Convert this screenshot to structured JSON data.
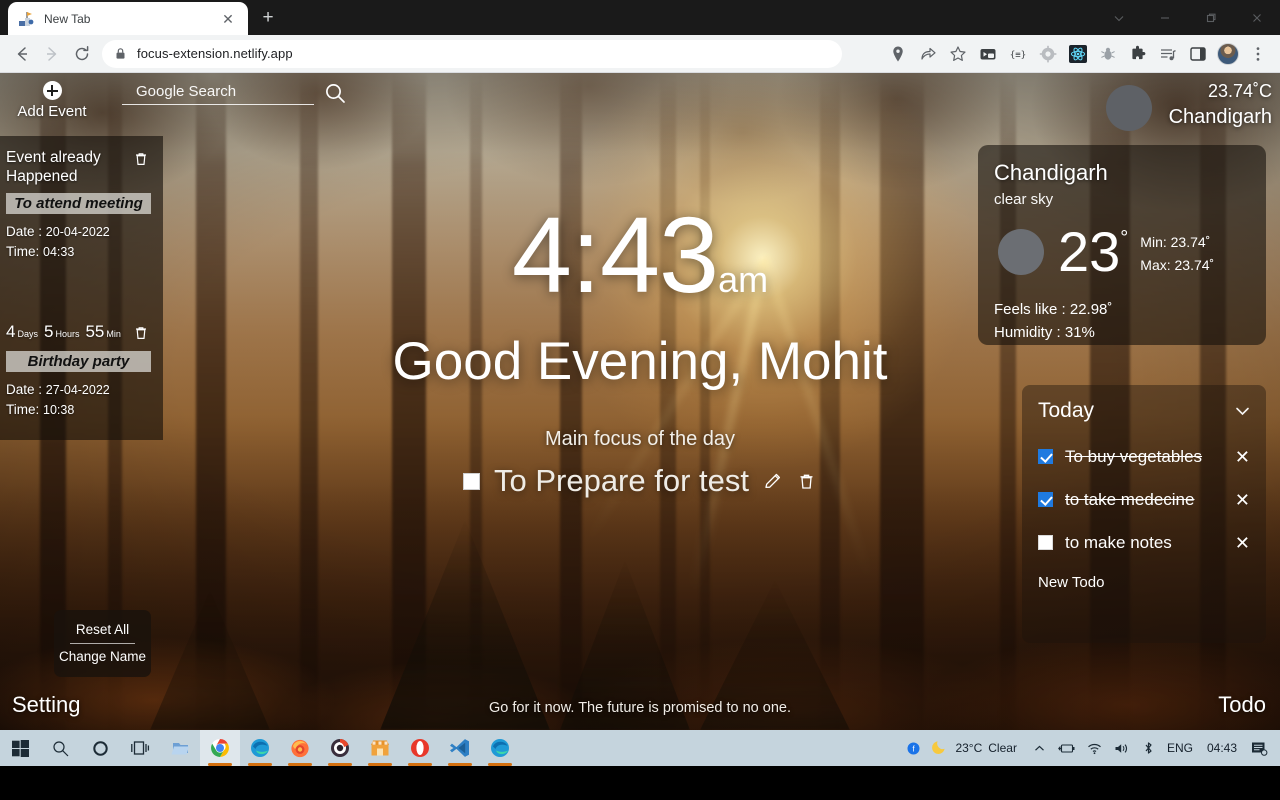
{
  "browser": {
    "tab": {
      "title": "New Tab",
      "favicon": "focus-extension-icon",
      "close": "✕"
    },
    "newtab_label": "+",
    "window_controls": {
      "chevron": "⌄",
      "minimize": "—",
      "maximize": "❐",
      "close": "✕"
    },
    "omnibox": {
      "url": "focus-extension.netlify.app",
      "lock": "lock-icon"
    },
    "extensions": [
      "video-picture-in-picture-icon",
      "json-formatter-icon",
      "gear-extension-icon",
      "react-devtools-icon",
      "debug-bug-icon",
      "extensions-puzzle-icon",
      "playlist-icon",
      "side-panel-icon"
    ],
    "menu": "⋮"
  },
  "page": {
    "add_event": {
      "label": "Add Event",
      "icon": "plus-circle-icon"
    },
    "search": {
      "placeholder": "Google Search",
      "value": "",
      "icon": "search-icon"
    },
    "events": [
      {
        "status": "Event already Happened",
        "countdown": null,
        "title": "To attend meeting",
        "date_label": "Date :",
        "date": "20-04-2022",
        "time_label": "Time:",
        "time": "04:33",
        "delete_icon": "trash-icon"
      },
      {
        "status": null,
        "countdown": {
          "days": "4",
          "days_unit": "Days",
          "hours": "5",
          "hours_unit": "Hours",
          "mins": "55",
          "mins_unit": "Min"
        },
        "title": "Birthday party",
        "date_label": "Date :",
        "date": "27-04-2022",
        "time_label": "Time:",
        "time": "10:38",
        "delete_icon": "trash-icon"
      }
    ],
    "clock": {
      "time": "4:43",
      "ampm": "am"
    },
    "greeting": "Good Evening, Mohit",
    "focus": {
      "label": "Main focus of the day",
      "task": "To Prepare for test",
      "checked": false,
      "edit_icon": "pencil-icon",
      "delete_icon": "trash-icon"
    },
    "weather_top": {
      "temp": "23.74˚C",
      "city": "Chandigarh",
      "icon": "weather-placeholder-circle"
    },
    "weather_card": {
      "city": "Chandigarh",
      "description": "clear sky",
      "temp": "23",
      "degree": "°",
      "min": "Min: 23.74˚",
      "max": "Max: 23.74˚",
      "feels_like": "Feels like : 22.98˚",
      "humidity": "Humidity : 31%",
      "icon": "weather-placeholder-circle"
    },
    "todo": {
      "header": "Today",
      "chevron": "⌄",
      "items": [
        {
          "text": "To buy vegetables",
          "checked": true,
          "remove": "✕"
        },
        {
          "text": "to take medecine",
          "checked": true,
          "remove": "✕"
        },
        {
          "text": "to make notes",
          "checked": false,
          "remove": "✕"
        }
      ],
      "new_placeholder": "New Todo"
    },
    "settings_popup": {
      "reset": "Reset All",
      "change_name": "Change Name"
    },
    "setting_label": "Setting",
    "todo_label": "Todo",
    "quote": "Go for it now. The future is promised to no one."
  },
  "taskbar": {
    "apps": [
      "windows-start-icon",
      "search-icon",
      "cortana-icon",
      "task-view-icon",
      "file-explorer-icon",
      "chrome-icon",
      "edge-icon",
      "firefox-icon",
      "opera-gx-icon",
      "microsoft-store-icon",
      "opera-icon",
      "vscode-icon",
      "edge-dev-icon"
    ],
    "tray": {
      "meet_icon": "meet-icon",
      "weather_icon": "moon-icon",
      "weather_temp": "23°C",
      "weather_desc": "Clear",
      "chevron": "⌃",
      "battery_icon": "battery-icon",
      "wifi_icon": "wifi-icon",
      "volume_icon": "volume-icon",
      "bluetooth_icon": "bluetooth-icon",
      "language": "ENG",
      "clock": "04:43",
      "notification_icon": "notification-icon"
    }
  },
  "colors": {
    "accent_blue": "#1f7ae0",
    "taskbar_bg": "#c5d4dd",
    "chrome_toolbar": "#f1f3f4",
    "tab_bg": "#1a1a1a"
  }
}
